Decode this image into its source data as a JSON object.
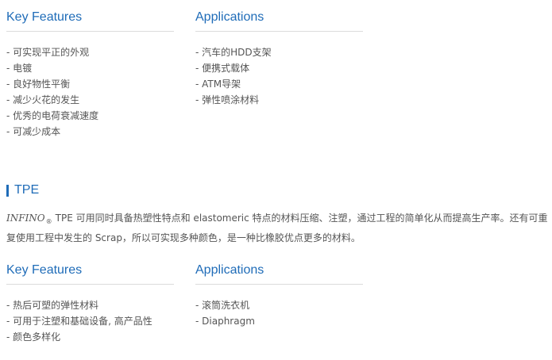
{
  "block1": {
    "features": {
      "title": "Key Features",
      "items": [
        "可实现平正的外观",
        "电镀",
        "良好物性平衡",
        "减少火花的发生",
        "优秀的电荷衰减速度",
        "可减少成本"
      ]
    },
    "applications": {
      "title": "Applications",
      "items": [
        "汽车的HDD支架",
        "便携式载体",
        "ATM导架",
        "弹性喷涂材料"
      ]
    }
  },
  "tpe": {
    "title": "TPE",
    "brand": "INFINO",
    "reg_mark": "®",
    "description": "TPE 可用同时具备热塑性特点和 elastomeric 特点的材料压缩、注塑，通过工程的简单化从而提高生产率。还有可重复使用工程中发生的 Scrap，所以可实现多种颜色，是一种比橡胶优点更多的材料。"
  },
  "block2": {
    "features": {
      "title": "Key Features",
      "items": [
        "热后可塑的弹性材料",
        "可用于注塑和基础设备, 高产品性",
        "颜色多样化"
      ]
    },
    "applications": {
      "title": "Applications",
      "items": [
        "滚筒洗衣机",
        "Diaphragm"
      ]
    }
  },
  "colors": {
    "accent": "#1f6cb8",
    "text": "#555555",
    "divider": "#dcdcdc"
  }
}
